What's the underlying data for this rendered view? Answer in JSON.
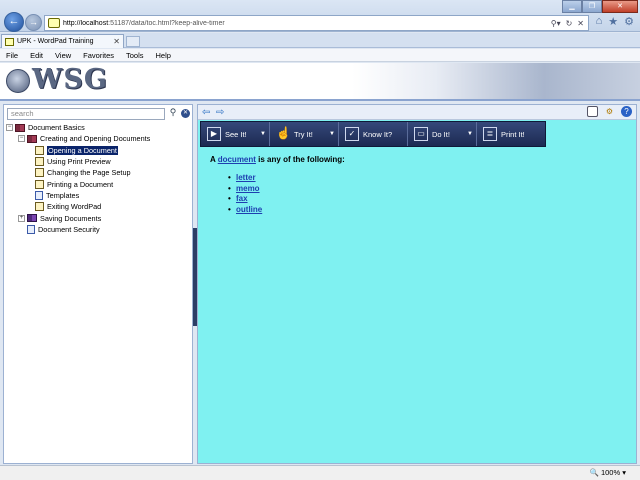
{
  "browser": {
    "url_host": "http://localhost",
    "url_rest": ":51187/data/toc.html?keep-alive-timer",
    "tab_title": "UPK - WordPad Training",
    "menu": [
      "File",
      "Edit",
      "View",
      "Favorites",
      "Tools",
      "Help"
    ],
    "zoom": "100%"
  },
  "banner": {
    "logo": "WSG"
  },
  "left": {
    "search_placeholder": "search",
    "tree": {
      "root": "Document Basics",
      "creating": "Creating and Opening Documents",
      "items": [
        "Opening a Document",
        "Using Print Preview",
        "Changing the Page Setup",
        "Printing a Document",
        "Templates",
        "Exiting WordPad"
      ],
      "saving": "Saving Documents",
      "security": "Document Security"
    }
  },
  "modes": {
    "see": "See It!",
    "try": "Try It!",
    "know": "Know It?",
    "do": "Do It!",
    "print": "Print It!"
  },
  "content": {
    "prefix": "A ",
    "link": "document",
    "suffix": " is any of the following:",
    "items": [
      "letter",
      "memo",
      "fax",
      "outline"
    ]
  }
}
